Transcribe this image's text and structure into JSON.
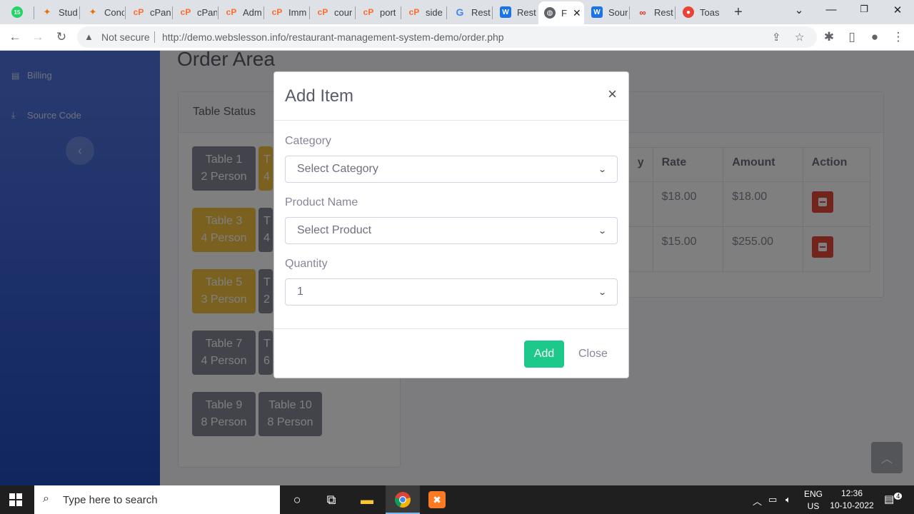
{
  "browser": {
    "tabs": [
      {
        "label": "",
        "icon": "whatsapp-icon",
        "color": "#25d366"
      },
      {
        "label": "Stud",
        "icon": "webslesson-icon",
        "color": "#e8710a"
      },
      {
        "label": "Conc",
        "icon": "webslesson-icon",
        "color": "#e8710a"
      },
      {
        "label": "cPan",
        "icon": "cpanel-icon",
        "color": "#ff6c2c"
      },
      {
        "label": "cPan",
        "icon": "cpanel-icon",
        "color": "#ff6c2c"
      },
      {
        "label": "Adm",
        "icon": "cpanel-icon",
        "color": "#ff6c2c"
      },
      {
        "label": "Imm",
        "icon": "cpanel-icon",
        "color": "#ff6c2c"
      },
      {
        "label": "cour",
        "icon": "cpanel-icon",
        "color": "#ff6c2c"
      },
      {
        "label": "port",
        "icon": "cpanel-icon",
        "color": "#ff6c2c"
      },
      {
        "label": "side",
        "icon": "cpanel-icon",
        "color": "#ff6c2c"
      },
      {
        "label": "Rest",
        "icon": "google-icon",
        "color": "#4285f4"
      },
      {
        "label": "Rest",
        "icon": "word-icon",
        "color": "#1a73e8"
      },
      {
        "label": "F",
        "icon": "globe-icon",
        "color": "#5f6368"
      },
      {
        "label": "Sour",
        "icon": "word-icon",
        "color": "#1a73e8"
      },
      {
        "label": "Rest",
        "icon": "infinity-icon",
        "color": "#d93025"
      },
      {
        "label": "Toas",
        "icon": "toast-icon",
        "color": "#ea4335"
      }
    ],
    "whatsapp_badge": "15",
    "not_secure": "Not secure",
    "url": "http://demo.webslesson.info/restaurant-management-system-demo/order.php"
  },
  "sidebar": {
    "items": [
      {
        "label": "Billing",
        "icon": "file-icon"
      },
      {
        "label": "Source Code",
        "icon": "download-icon"
      }
    ]
  },
  "page": {
    "title": "Order Area",
    "table_status_title": "Table Status",
    "tables": [
      {
        "name": "Table 1",
        "persons": "2 Person",
        "status": "free"
      },
      {
        "name": "T",
        "persons": "4",
        "status": "busy"
      },
      {
        "name": "Table 3",
        "persons": "4 Person",
        "status": "busy"
      },
      {
        "name": "T",
        "persons": "4",
        "status": "free"
      },
      {
        "name": "Table 5",
        "persons": "3 Person",
        "status": "busy"
      },
      {
        "name": "T",
        "persons": "2",
        "status": "free"
      },
      {
        "name": "Table 7",
        "persons": "4 Person",
        "status": "free"
      },
      {
        "name": "T",
        "persons": "6",
        "status": "free"
      },
      {
        "name": "Table 9",
        "persons": "8 Person",
        "status": "free"
      },
      {
        "name": "Table 10",
        "persons": "8 Person",
        "status": "free"
      }
    ],
    "order_table": {
      "headers": [
        "y",
        "Rate",
        "Amount",
        "Action"
      ],
      "rows": [
        {
          "rate": "$18.00",
          "amount": "$18.00"
        },
        {
          "rate": "$15.00",
          "amount": "$255.00"
        }
      ]
    }
  },
  "modal": {
    "title": "Add Item",
    "close_glyph": "×",
    "category_label": "Category",
    "category_value": "Select Category",
    "product_label": "Product Name",
    "product_value": "Select Product",
    "quantity_label": "Quantity",
    "quantity_value": "1",
    "add_button": "Add",
    "close_button": "Close"
  },
  "taskbar": {
    "search_placeholder": "Type here to search",
    "lang_top": "ENG",
    "lang_bottom": "US",
    "time": "12:36",
    "date": "10-10-2022",
    "notification_count": "4"
  },
  "colors": {
    "primary": "#4e73df",
    "success": "#1cc88a",
    "warning": "#f6c23e",
    "danger": "#e74a3b",
    "secondary": "#858796"
  }
}
